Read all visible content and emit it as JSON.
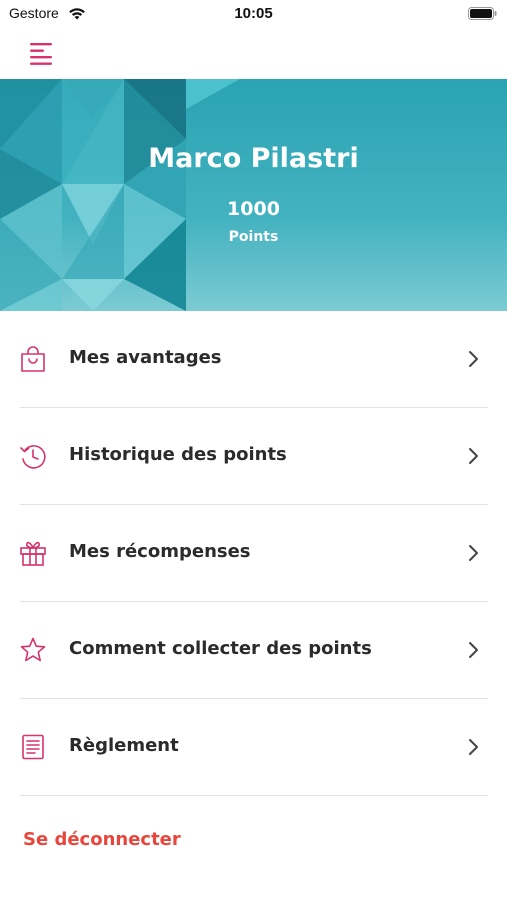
{
  "status_bar": {
    "carrier": "Gestore",
    "time": "10:05"
  },
  "header": {
    "menu_icon": "hamburger-menu-icon",
    "user_name": "Marco Pilastri",
    "points_value": "1000",
    "points_label": "Points"
  },
  "menu": {
    "items": [
      {
        "label": "Mes avantages",
        "icon": "shopping-bag-icon"
      },
      {
        "label": "Historique des points",
        "icon": "history-clock-icon"
      },
      {
        "label": "Mes récompenses",
        "icon": "gift-icon"
      },
      {
        "label": "Comment collecter des points",
        "icon": "star-icon"
      },
      {
        "label": "Règlement",
        "icon": "document-icon"
      }
    ]
  },
  "logout_label": "Se déconnecter",
  "colors": {
    "accent": "#d6336c",
    "logout": "#e8463c",
    "banner": "#3aaebc"
  }
}
